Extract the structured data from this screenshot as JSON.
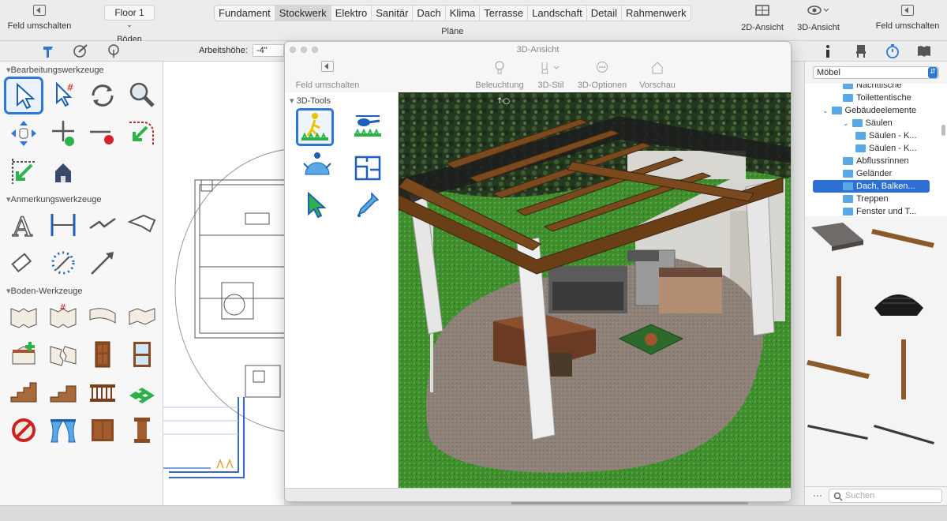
{
  "toolbar": {
    "left_toggle_label": "Feld umschalten",
    "floor_select_value": "Floor 1",
    "floors_label": "Böden",
    "plan_tabs": [
      "Fundament",
      "Stockwerk",
      "Elektro",
      "Sanitär",
      "Dach",
      "Klima",
      "Terrasse",
      "Landschaft",
      "Detail",
      "Rahmenwerk"
    ],
    "active_tab": "Stockwerk",
    "plans_label": "Pläne",
    "view2d_label": "2D-Ansicht",
    "view3d_label": "3D-Ansicht",
    "right_toggle_label": "Feld umschalten"
  },
  "workheight": {
    "label": "Arbeitshöhe:",
    "value": "-4\""
  },
  "left_panel": {
    "sections": [
      "Bearbeitungswerkzeuge",
      "Anmerkungswerkzeuge",
      "Boden-Werkzeuge"
    ]
  },
  "window3d": {
    "title": "3D-Ansicht",
    "toggle_label": "Feld umschalten",
    "buttons": [
      "Beleuchtung",
      "3D-Stil",
      "3D-Optionen",
      "Vorschau"
    ],
    "tools_header": "3D-Tools"
  },
  "right_panel": {
    "library_select": "Möbel",
    "tree": [
      {
        "label": "Nachttische",
        "level": 2
      },
      {
        "label": "Toilettentische",
        "level": 2
      },
      {
        "label": "Gebäudeelemente",
        "level": 1
      },
      {
        "label": "Säulen",
        "level": 2
      },
      {
        "label": "Säulen - K...",
        "level": 3
      },
      {
        "label": "Säulen - K...",
        "level": 3
      },
      {
        "label": "Abflussrinnen",
        "level": 2
      },
      {
        "label": "Geländer",
        "level": 2
      },
      {
        "label": "Dach, Balken...",
        "level": 2,
        "selected": true
      },
      {
        "label": "Treppen",
        "level": 2
      },
      {
        "label": "Fenster und T...",
        "level": 2
      }
    ],
    "search_placeholder": "Suchen"
  },
  "colors": {
    "accent": "#2d77d8",
    "grass": "#3f8f2e",
    "wood": "#7a4a1e",
    "patio": "#8d8178"
  }
}
